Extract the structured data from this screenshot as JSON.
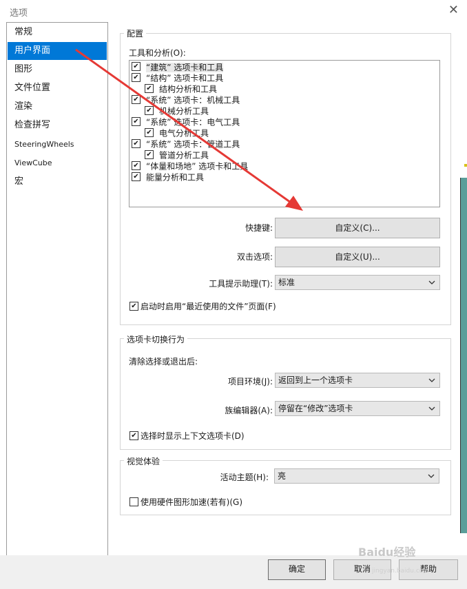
{
  "window": {
    "title": "选项"
  },
  "sidebar": {
    "items": [
      {
        "label": "常规"
      },
      {
        "label": "用户界面",
        "selected": true
      },
      {
        "label": "图形"
      },
      {
        "label": "文件位置"
      },
      {
        "label": "渲染"
      },
      {
        "label": "检查拼写"
      },
      {
        "label": "SteeringWheels"
      },
      {
        "label": "ViewCube"
      },
      {
        "label": "宏"
      }
    ]
  },
  "config": {
    "group_label": "配置",
    "tools_label": "工具和分析(O):",
    "tree": [
      {
        "label": "“建筑” 选项卡和工具",
        "checked": true,
        "level": 0
      },
      {
        "label": "“结构” 选项卡和工具",
        "checked": true,
        "level": 0
      },
      {
        "label": "结构分析和工具",
        "checked": true,
        "level": 1
      },
      {
        "label": "“系统” 选项卡：机械工具",
        "checked": true,
        "level": 0
      },
      {
        "label": "机械分析工具",
        "checked": true,
        "level": 1
      },
      {
        "label": "“系统” 选项卡：电气工具",
        "checked": true,
        "level": 0
      },
      {
        "label": "电气分析工具",
        "checked": true,
        "level": 1
      },
      {
        "label": "“系统” 选项卡：管道工具",
        "checked": true,
        "level": 0
      },
      {
        "label": "管道分析工具",
        "checked": true,
        "level": 1
      },
      {
        "label": "“体量和场地” 选项卡和工具",
        "checked": true,
        "level": 0
      },
      {
        "label": "能量分析和工具",
        "checked": true,
        "level": 0
      }
    ],
    "shortcut_label": "快捷键:",
    "shortcut_button": "自定义(C)...",
    "doubleclick_label": "双击选项:",
    "doubleclick_button": "自定义(U)...",
    "tooltip_label": "工具提示助理(T):",
    "tooltip_value": "标准",
    "recent_files_label": "启动时启用“最近使用的文件”页面(F)",
    "recent_files_checked": true
  },
  "tab_switch": {
    "group_label": "选项卡切换行为",
    "clear_label": "清除选择或退出后:",
    "project_label": "项目环境(J):",
    "project_value": "返回到上一个选项卡",
    "family_label": "族编辑器(A):",
    "family_value": "停留在“修改”选项卡",
    "context_label": "选择时显示上下文选项卡(D)",
    "context_checked": true
  },
  "visual": {
    "group_label": "视觉体验",
    "theme_label": "活动主题(H):",
    "theme_value": "亮",
    "hw_label": "使用硬件图形加速(若有)(G)",
    "hw_checked": false
  },
  "footer": {
    "ok": "确定",
    "cancel": "取消",
    "help": "帮助"
  },
  "watermark": {
    "text": "Baidu经验",
    "sub": "jingyan.baidu.com"
  },
  "colors": {
    "selection": "#0078d7",
    "annotation_arrow": "#e53935"
  }
}
